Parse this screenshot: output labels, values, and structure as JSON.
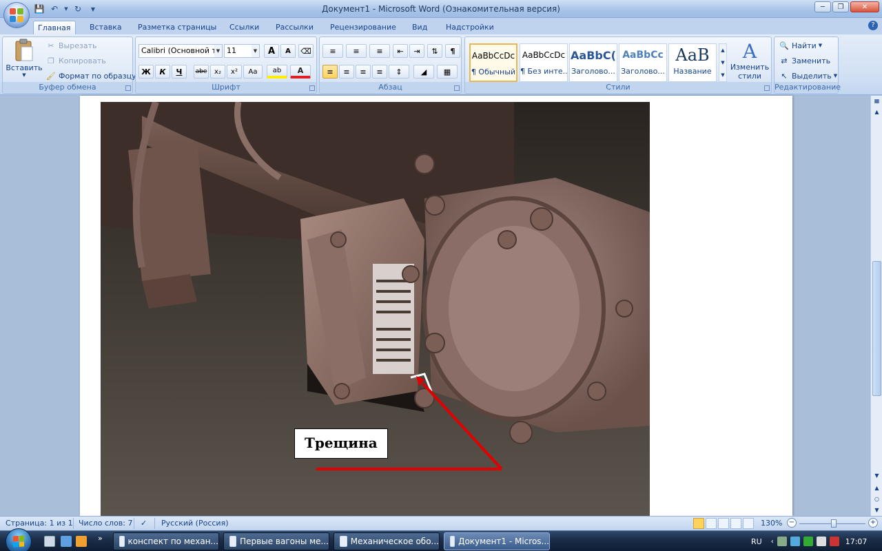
{
  "window": {
    "title": "Документ1 - Microsoft Word (Ознакомительная версия)"
  },
  "tabs": [
    {
      "label": "Главная",
      "active": true
    },
    {
      "label": "Вставка"
    },
    {
      "label": "Разметка страницы"
    },
    {
      "label": "Ссылки"
    },
    {
      "label": "Рассылки"
    },
    {
      "label": "Рецензирование"
    },
    {
      "label": "Вид"
    },
    {
      "label": "Надстройки"
    }
  ],
  "ribbon": {
    "clipboard": {
      "paste_label": "Вставить",
      "cut_label": "Вырезать",
      "copy_label": "Копировать",
      "format_painter_label": "Формат по образцу",
      "group_label": "Буфер обмена"
    },
    "font": {
      "font_name": "Calibri (Основной те",
      "font_size": "11",
      "grow": "A",
      "shrink": "A",
      "bold": "Ж",
      "italic": "К",
      "underline": "Ч",
      "strike": "abe",
      "subscript": "x₂",
      "superscript": "x²",
      "case": "Aa",
      "highlight": "ab",
      "font_color": "A",
      "group_label": "Шрифт"
    },
    "paragraph": {
      "pilcrow": "¶",
      "group_label": "Абзац"
    },
    "styles": {
      "items": [
        {
          "preview": "AaBbCcDc",
          "name": "¶ Обычный"
        },
        {
          "preview": "AaBbCcDc",
          "name": "¶ Без инте..."
        },
        {
          "preview": "AaBbC(",
          "name": "Заголово..."
        },
        {
          "preview": "AaBbCc",
          "name": "Заголово..."
        },
        {
          "preview": "AaB",
          "name": "Название"
        }
      ],
      "change_styles_label": "Изменить стили",
      "group_label": "Стили"
    },
    "editing": {
      "find_label": "Найти",
      "replace_label": "Заменить",
      "select_label": "Выделить",
      "group_label": "Редактирование"
    }
  },
  "document": {
    "callout_text": "Трещина"
  },
  "statusbar": {
    "page": "Страница: 1 из 1",
    "words": "Число слов: 7",
    "language": "Русский (Россия)",
    "zoom": "130%"
  },
  "taskbar": {
    "buttons": [
      {
        "label": "конспект по механ..."
      },
      {
        "label": "Первые вагоны ме..."
      },
      {
        "label": "Механическое обо..."
      },
      {
        "label": "Документ1 - Micros...",
        "active": true
      }
    ],
    "lang": "RU",
    "time": "17:07"
  }
}
